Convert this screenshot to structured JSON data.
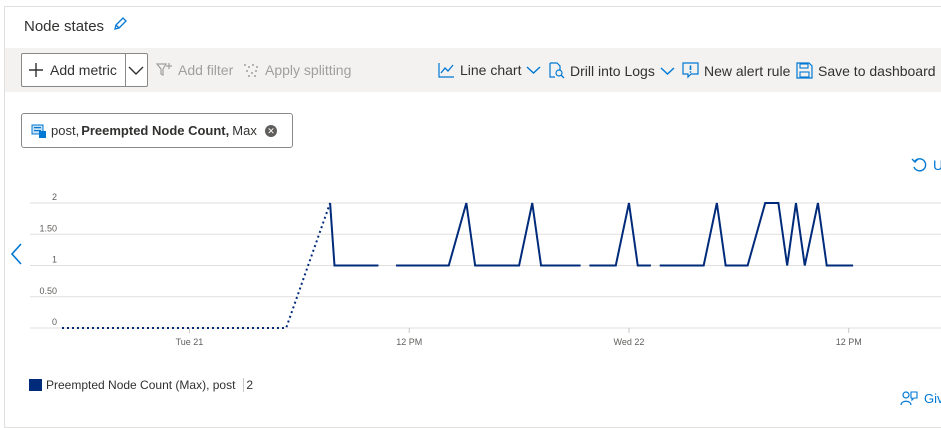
{
  "panel": {
    "title": "Node states"
  },
  "toolbar": {
    "add_metric_label": "Add metric",
    "add_filter_label": "Add filter",
    "apply_splitting_label": "Apply splitting",
    "line_chart_label": "Line chart",
    "drill_logs_label": "Drill into Logs",
    "new_alert_label": "New alert rule",
    "save_dashboard_label": "Save to dashboard"
  },
  "metric_pill": {
    "prefix": "post,",
    "metric": "Preempted Node Count,",
    "aggregation": "Max"
  },
  "undo_label": "U",
  "feedback_label": "Giv",
  "legend": {
    "label": "Preempted Node Count (Max), post",
    "value": "2"
  },
  "colors": {
    "series": "#002b7a",
    "accent": "#0078d4",
    "toolbar_bg": "#f3f2f1"
  },
  "chart_data": {
    "type": "line",
    "y_ticks": [
      "0",
      "0.50",
      "1",
      "1.50",
      "2"
    ],
    "ylim": [
      0,
      2
    ],
    "x_tick_labels": [
      "Tue 21",
      "12 PM",
      "Wed 22",
      "12 PM"
    ],
    "grid": true,
    "series": [
      {
        "name": "Preempted Node Count (Max), post",
        "note_gaps": "dotted segments where data missing",
        "segments": [
          {
            "style": "dotted",
            "points": [
              [
                0,
                0
              ],
              [
                0.06,
                0
              ],
              [
                0.12,
                0
              ],
              [
                0.19,
                0
              ],
              [
                0.255,
                0
              ],
              [
                0.305,
                2
              ]
            ]
          },
          {
            "style": "solid",
            "points": [
              [
                0.305,
                2
              ],
              [
                0.31,
                1
              ],
              [
                0.36,
                1
              ]
            ]
          },
          {
            "style": "solid",
            "points": [
              [
                0.38,
                1
              ],
              [
                0.44,
                1
              ],
              [
                0.46,
                2
              ],
              [
                0.47,
                1
              ],
              [
                0.52,
                1
              ],
              [
                0.535,
                2
              ],
              [
                0.545,
                1
              ],
              [
                0.59,
                1
              ]
            ]
          },
          {
            "style": "solid",
            "points": [
              [
                0.6,
                1
              ],
              [
                0.63,
                1
              ],
              [
                0.645,
                2
              ],
              [
                0.655,
                1
              ],
              [
                0.67,
                1
              ]
            ]
          },
          {
            "style": "solid",
            "points": [
              [
                0.68,
                1
              ],
              [
                0.73,
                1
              ],
              [
                0.745,
                2
              ],
              [
                0.755,
                1
              ],
              [
                0.78,
                1
              ],
              [
                0.8,
                2
              ],
              [
                0.815,
                2
              ],
              [
                0.825,
                1
              ],
              [
                0.835,
                2
              ],
              [
                0.845,
                1
              ],
              [
                0.86,
                2
              ],
              [
                0.87,
                1
              ],
              [
                0.9,
                1
              ]
            ]
          }
        ]
      }
    ]
  }
}
